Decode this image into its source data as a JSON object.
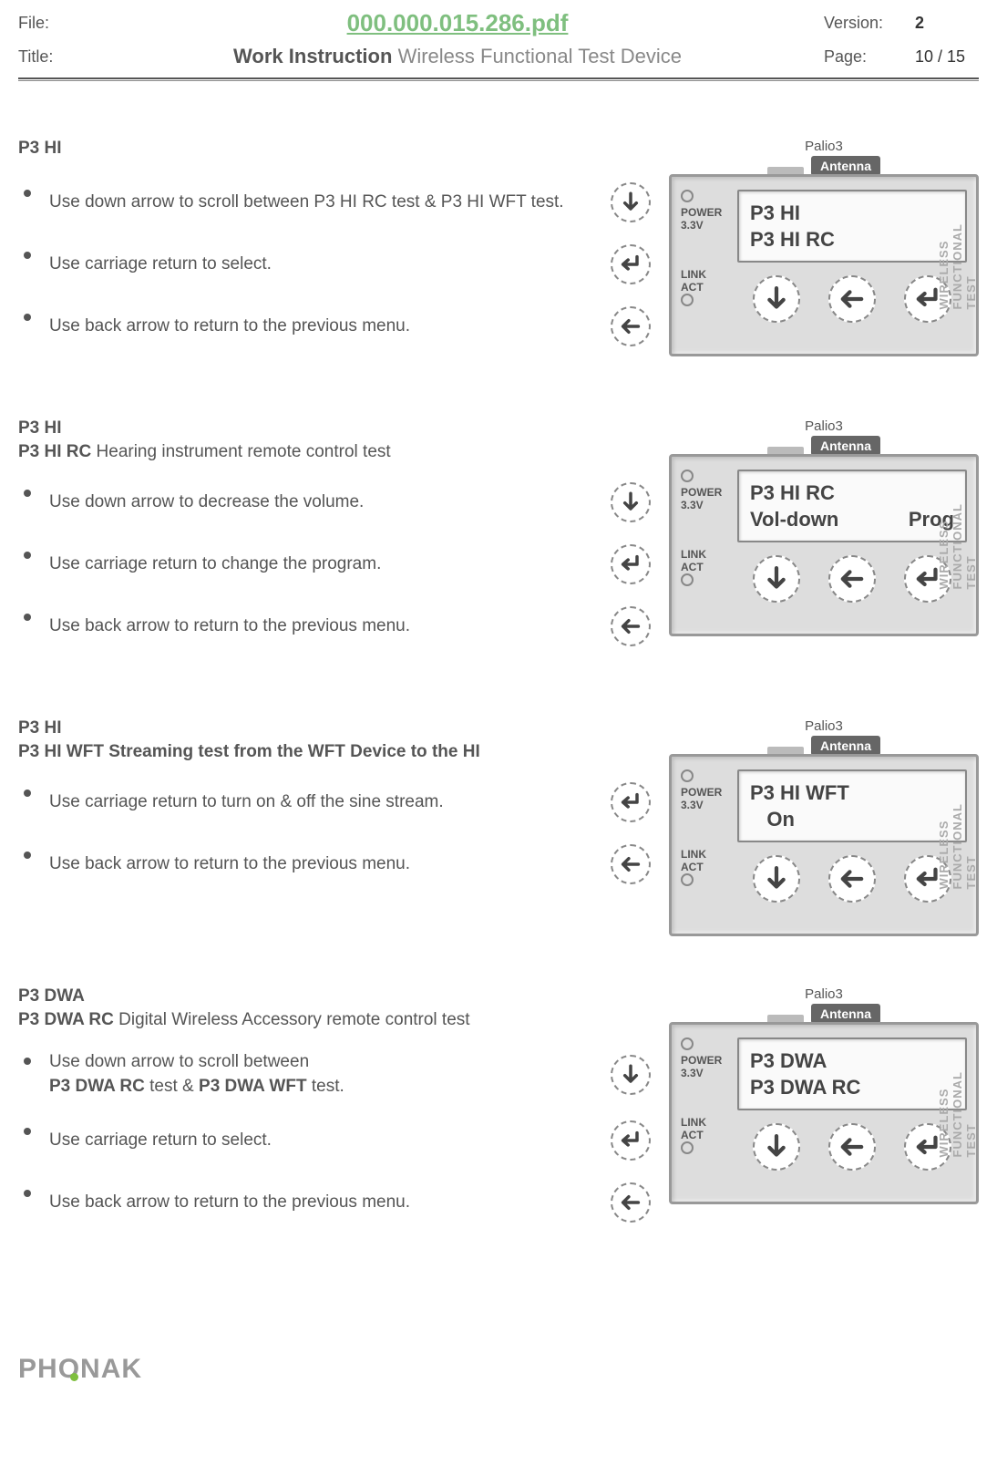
{
  "header": {
    "file_label": "File:",
    "file_value": "000.000.015.286.pdf",
    "version_label": "Version:",
    "version_value": "2",
    "title_label": "Title:",
    "title_bold": "Work Instruction",
    "title_rest": "Wireless Functional Test Device",
    "page_label": "Page:",
    "page_value": "10 / 15"
  },
  "device_common": {
    "top_label": "Palio3",
    "antenna": "Antenna",
    "power": "POWER",
    "power_v": "3.3V",
    "link": "LINK",
    "act": "ACT",
    "side_text": "WIRELESS FUNCTIONAL TEST"
  },
  "sections": [
    {
      "title": "P3 HI",
      "subtitle_bold": "",
      "subtitle_rest": "",
      "bullets": [
        {
          "text": "Use down arrow to scroll between P3 HI RC test & P3 HI WFT test.",
          "icon": "down"
        },
        {
          "text": "Use carriage return to select.",
          "icon": "return"
        },
        {
          "text": "Use back arrow to return to the previous menu.",
          "icon": "back"
        }
      ],
      "screen": {
        "line1": "P3 HI",
        "line2_left": "P3 HI RC",
        "line2_right": ""
      }
    },
    {
      "title": "P3 HI",
      "subtitle_bold": "P3 HI RC",
      "subtitle_rest": "Hearing instrument remote control test",
      "bullets": [
        {
          "text": "Use down arrow to decrease the volume.",
          "icon": "down"
        },
        {
          "text": "Use carriage return to change the program.",
          "icon": "return"
        },
        {
          "text": "Use back arrow to return to the previous menu.",
          "icon": "back"
        }
      ],
      "screen": {
        "line1": "P3 HI RC",
        "line2_left": "Vol-down",
        "line2_right": "Prog"
      }
    },
    {
      "title": "P3 HI",
      "subtitle_bold": "P3 HI WFT Streaming test from the WFT Device to the HI",
      "subtitle_rest": "",
      "bullets": [
        {
          "text": "Use carriage return to turn on & off the sine stream.",
          "icon": "return"
        },
        {
          "text": "Use back arrow to return to the previous menu.",
          "icon": "back"
        }
      ],
      "screen": {
        "line1": "P3 HI WFT",
        "line2_left": "   On",
        "line2_right": ""
      }
    },
    {
      "title": "P3 DWA",
      "subtitle_bold": "P3 DWA RC",
      "subtitle_rest": "Digital Wireless Accessory remote control test",
      "bullets": [
        {
          "html": "Use down arrow to scroll between<br><b>P3 DWA RC</b> test & <b>P3 DWA WFT</b> test.",
          "icon": "down"
        },
        {
          "text": "Use carriage return to select.",
          "icon": "return"
        },
        {
          "text": "Use back arrow to return to the previous menu.",
          "icon": "back"
        }
      ],
      "screen": {
        "line1": "P3 DWA",
        "line2_left": "P3 DWA RC",
        "line2_right": ""
      }
    }
  ],
  "brand": {
    "p1": "PH",
    "o": "O",
    "p2": "NAK"
  }
}
